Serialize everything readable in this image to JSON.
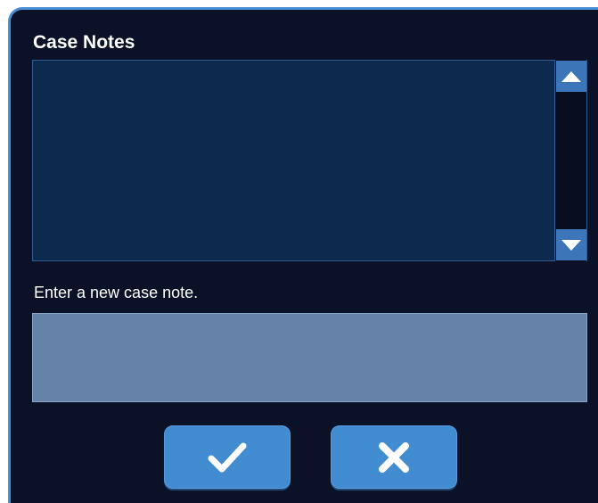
{
  "dialog": {
    "title": "Case Notes",
    "notes": [],
    "scroll_up_icon": "arrow-up-icon",
    "scroll_down_icon": "arrow-down-icon",
    "new_note_prompt": "Enter a new case note.",
    "new_note_value": "",
    "confirm_icon": "checkmark-icon",
    "cancel_icon": "x-icon"
  },
  "colors": {
    "background": "#0b1227",
    "border_accent": "#4a8fd6",
    "notes_area": "#0b2a4d",
    "input_field": "#6582a8",
    "button": "#418bd0",
    "scroll_button": "#3c75b8"
  }
}
